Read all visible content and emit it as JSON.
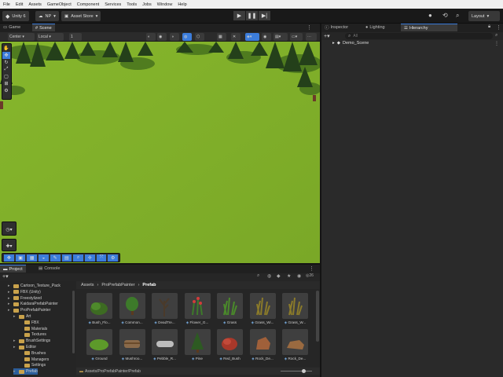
{
  "menu": [
    "File",
    "Edit",
    "Assets",
    "GameObject",
    "Component",
    "Services",
    "Tools",
    "Jobs",
    "Window",
    "Help"
  ],
  "toolbar": {
    "unity_label": "Unity 6",
    "account": "NP",
    "asset_store": "Asset Store",
    "layout": "Layout"
  },
  "scene_tabs": [
    "Game",
    "Scene"
  ],
  "scene_toolbar": {
    "pivot": "Center",
    "space": "Local",
    "grid": "1"
  },
  "right_tabs": [
    "Inspector",
    "Lighting",
    "Hierarchy"
  ],
  "hierarchy": {
    "search_placeholder": "All",
    "scene_name": "Demo_Scene"
  },
  "bottom_tabs": [
    "Project",
    "Console"
  ],
  "project": {
    "count": "26",
    "breadcrumb": [
      "Assets",
      "ProPrefabPainter",
      "Prefab"
    ],
    "status_path": "Assets/ProPrefabPainter/Prefab",
    "tree": [
      {
        "label": "Cartoon_Texture_Pack",
        "depth": 1
      },
      {
        "label": "FBX (Unity)",
        "depth": 1
      },
      {
        "label": "Freestylized",
        "depth": 1
      },
      {
        "label": "KaidaraPrefabPainter",
        "depth": 1
      },
      {
        "label": "ProPrefabPainter",
        "depth": 1
      },
      {
        "label": "Art",
        "depth": 2
      },
      {
        "label": "FBX",
        "depth": 3
      },
      {
        "label": "Materials",
        "depth": 3
      },
      {
        "label": "Textures",
        "depth": 3
      },
      {
        "label": "BrushSettings",
        "depth": 2
      },
      {
        "label": "Editor",
        "depth": 2
      },
      {
        "label": "Brushes",
        "depth": 3
      },
      {
        "label": "Managers",
        "depth": 3
      },
      {
        "label": "Settings",
        "depth": 3
      },
      {
        "label": "Prefab",
        "depth": 2
      }
    ],
    "assets": [
      {
        "label": "Bush_Flo...",
        "kind": "bush"
      },
      {
        "label": "Common...",
        "kind": "tree"
      },
      {
        "label": "DeadTre...",
        "kind": "deadtree"
      },
      {
        "label": "Flower_G...",
        "kind": "flower"
      },
      {
        "label": "Grass",
        "kind": "grass"
      },
      {
        "label": "Grass_Wi...",
        "kind": "grassdry"
      },
      {
        "label": "Grass_W...",
        "kind": "grassdry"
      },
      {
        "label": "Ground",
        "kind": "ground"
      },
      {
        "label": "Mushroo...",
        "kind": "log"
      },
      {
        "label": "Pebble_R...",
        "kind": "pebble"
      },
      {
        "label": "Pine",
        "kind": "pine"
      },
      {
        "label": "Red_Bush",
        "kind": "redbush"
      },
      {
        "label": "Rock_De...",
        "kind": "rock"
      },
      {
        "label": "Rock_De...",
        "kind": "rock2"
      }
    ]
  },
  "colors": {
    "accent": "#3c7ddb",
    "scene_grass": "#7fb02a",
    "folder": "#c9a24b"
  }
}
